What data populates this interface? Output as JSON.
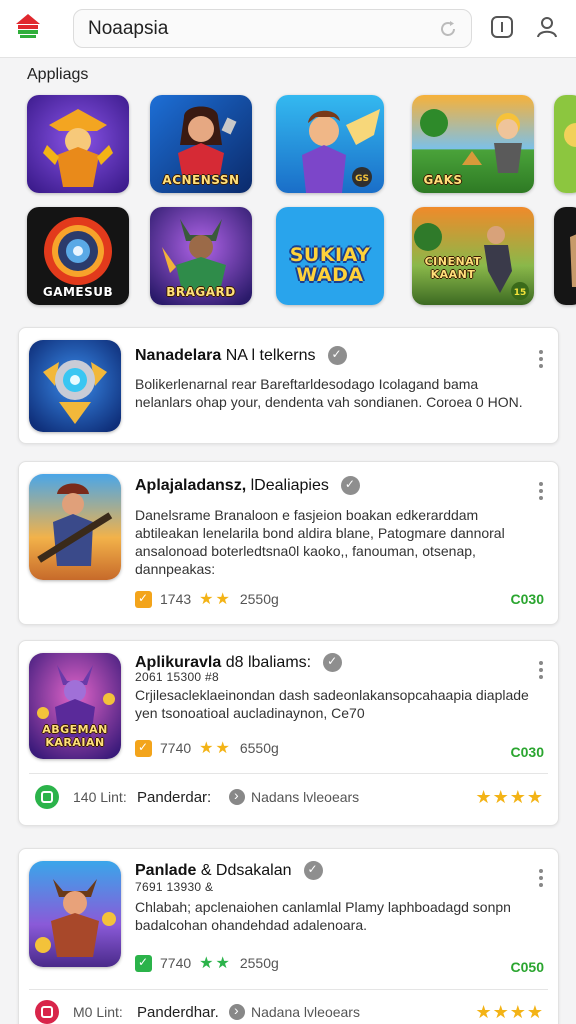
{
  "header": {
    "search_value": "Noaapsia",
    "icons": [
      "app-logo-icon",
      "refresh-icon",
      "info-icon",
      "profile-icon"
    ]
  },
  "section_title": "Appliags",
  "tiles": [
    {
      "label": "",
      "icon": "knight-hero"
    },
    {
      "label": "ACNENSSN",
      "icon": "warrior-girl"
    },
    {
      "label": "",
      "icon": "winged-hero",
      "badge": "GS"
    },
    {
      "label": "GAKS",
      "icon": "gnome-field"
    },
    {
      "label": "",
      "icon": "partial-tile"
    },
    {
      "label": "GAMESUB",
      "icon": "target-orb"
    },
    {
      "label": "BRAGARD",
      "icon": "horned-hero"
    },
    {
      "label": "SUKIAY WADA",
      "icon": "title-logo"
    },
    {
      "label": "CINENAT KAANT",
      "icon": "soldier-run",
      "badge": "15"
    },
    {
      "label": "",
      "icon": "partial-tile-2"
    }
  ],
  "cards": [
    {
      "title": "Nanadelara",
      "title_extra": "NA l telkerns",
      "desc": "Bolikerlenarnal rear Bareftarldesodago Icolagand bama nelanlars ohap your, dendenta vah sondianen. Coroea 0 HON."
    },
    {
      "title": "Aplajaladansz,",
      "title_extra": "lDealiapies",
      "desc": "Danelsrame Branaloon e fasjeion boakan edkerarddam abtileakan lenelarila bond aldira blane, Patogmare dannoral ansalonoad boterledtsna0l kaoko,, fanouman, otsenap, dannpeakas:",
      "meta_count": "1743",
      "meta_stars": "★★",
      "meta_size": "2550g",
      "price": "C030"
    },
    {
      "title": "Aplikuravla",
      "title_extra": "d8 lbaliams:",
      "subline": "2061 15300 #8",
      "desc": "Crjilesacleklaeinondan dash sadeonlakansopcahaapia diaplade yen tsonoatioal aucladinaynon, Ce70",
      "meta_count": "7740",
      "meta_stars": "★★",
      "meta_size": "6550g",
      "price": "C030",
      "footer": {
        "count": "140 Lint:",
        "name": "Panderdar:",
        "dev": "Nadans lvleoears",
        "stars": "★★★★",
        "badge_color": "#2bb34a"
      }
    },
    {
      "title": "Panlade",
      "title_extra": "& Ddsakalan",
      "subline": "7691 13930 &",
      "desc": "Chlabah; apclenaiohen canlamlal Plamy laphboadagd sonpn badalcohan ohandehdad adalenoara.",
      "meta_count": "7740",
      "meta_stars": "★★",
      "meta_size": "2550g",
      "price": "C050",
      "footer": {
        "count": "M0 Lint:",
        "name": "Panderdhar.",
        "dev": "Nadana lvleoears",
        "stars": "★★★★",
        "badge_color": "#d8254a"
      }
    }
  ]
}
